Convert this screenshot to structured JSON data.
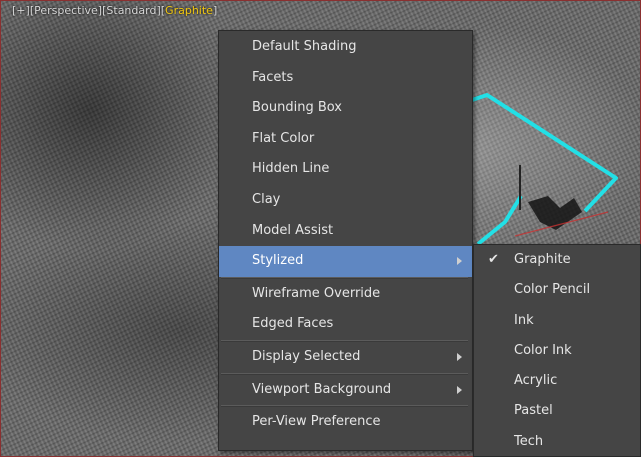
{
  "viewport": {
    "labels": [
      {
        "text": "[+]",
        "active": false
      },
      {
        "text": "[Perspective]",
        "active": false
      },
      {
        "text": "[Standard]",
        "active": false
      },
      {
        "text": "[Graphite]",
        "active": true
      }
    ]
  },
  "menu": {
    "items": [
      {
        "label": "Default Shading",
        "submenu": false,
        "highlight": false
      },
      {
        "label": "Facets",
        "submenu": false,
        "highlight": false
      },
      {
        "label": "Bounding Box",
        "submenu": false,
        "highlight": false
      },
      {
        "label": "Flat Color",
        "submenu": false,
        "highlight": false
      },
      {
        "label": "Hidden Line",
        "submenu": false,
        "highlight": false
      },
      {
        "label": "Clay",
        "submenu": false,
        "highlight": false
      },
      {
        "label": "Model Assist",
        "submenu": false,
        "highlight": false
      },
      {
        "label": "Stylized",
        "submenu": true,
        "highlight": true
      },
      {
        "separator": true
      },
      {
        "label": "Wireframe Override",
        "submenu": false,
        "highlight": false
      },
      {
        "label": "Edged Faces",
        "submenu": false,
        "highlight": false
      },
      {
        "separator": true
      },
      {
        "label": "Display Selected",
        "submenu": true,
        "highlight": false
      },
      {
        "separator": true
      },
      {
        "label": "Viewport Background",
        "submenu": true,
        "highlight": false
      },
      {
        "separator": true
      },
      {
        "label": "Per-View Preference",
        "submenu": false,
        "highlight": false
      }
    ]
  },
  "submenu": {
    "items": [
      {
        "label": "Graphite",
        "checked": true
      },
      {
        "label": "Color Pencil",
        "checked": false
      },
      {
        "label": "Ink",
        "checked": false
      },
      {
        "label": "Color Ink",
        "checked": false
      },
      {
        "label": "Acrylic",
        "checked": false
      },
      {
        "label": "Pastel",
        "checked": false
      },
      {
        "label": "Tech",
        "checked": false
      }
    ]
  },
  "colors": {
    "menu_bg": "#454545",
    "highlight": "#5f87c2",
    "active_label": "#f2c811",
    "selection_wire": "#22e0e6",
    "axis_red": "#c83232"
  },
  "icons": {
    "check": "checkmark-icon",
    "submenu_arrow": "submenu-arrow-icon"
  }
}
